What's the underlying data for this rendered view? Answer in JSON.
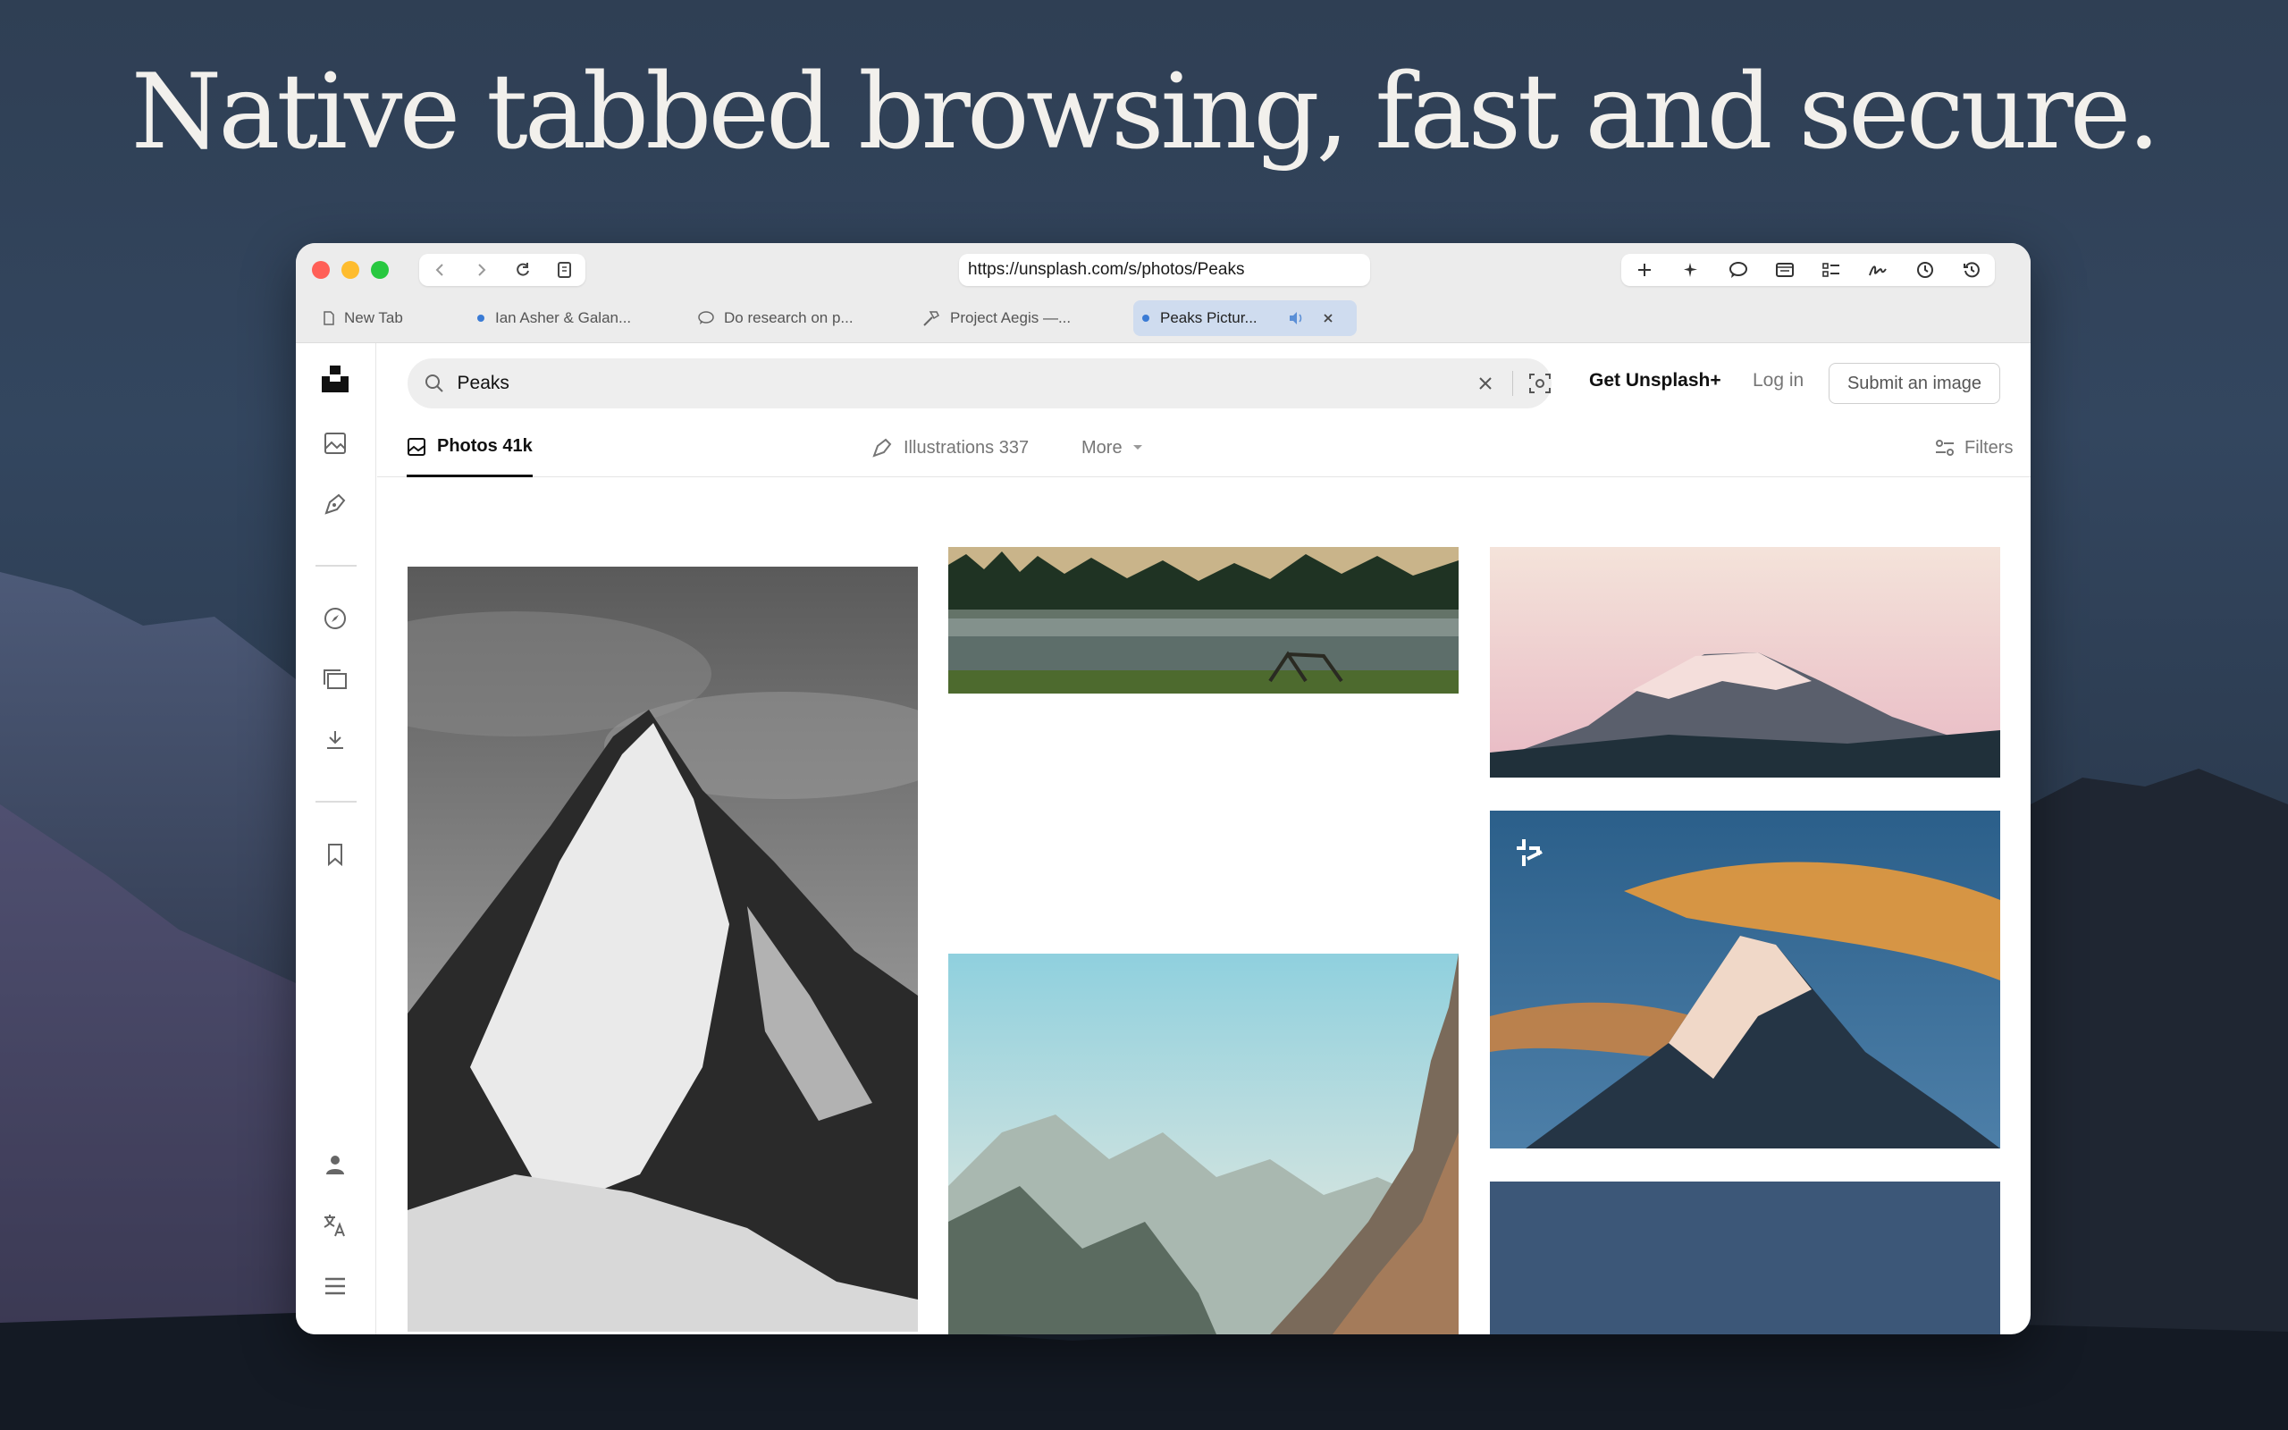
{
  "headline": "Native tabbed browsing, fast and secure.",
  "browser": {
    "url": "https://unsplash.com/s/photos/Peaks",
    "tabs": [
      {
        "title": "New Tab"
      },
      {
        "title": "Ian Asher & Galan..."
      },
      {
        "title": "Do research on p..."
      },
      {
        "title": "Project Aegis —..."
      },
      {
        "title": "Peaks Pictur..."
      }
    ],
    "colors": {
      "close": "#ff5f57",
      "minimize": "#febc2e",
      "zoom": "#28c840",
      "active_tab": "#cfdcef"
    }
  },
  "site": {
    "search": {
      "value": "Peaks"
    },
    "get_plus": "Get Unsplash+",
    "login": "Log in",
    "submit": "Submit an image",
    "filter_tabs": {
      "photos": "Photos 41k",
      "illustrations": "Illustrations 337",
      "more": "More"
    },
    "filters": "Filters"
  }
}
